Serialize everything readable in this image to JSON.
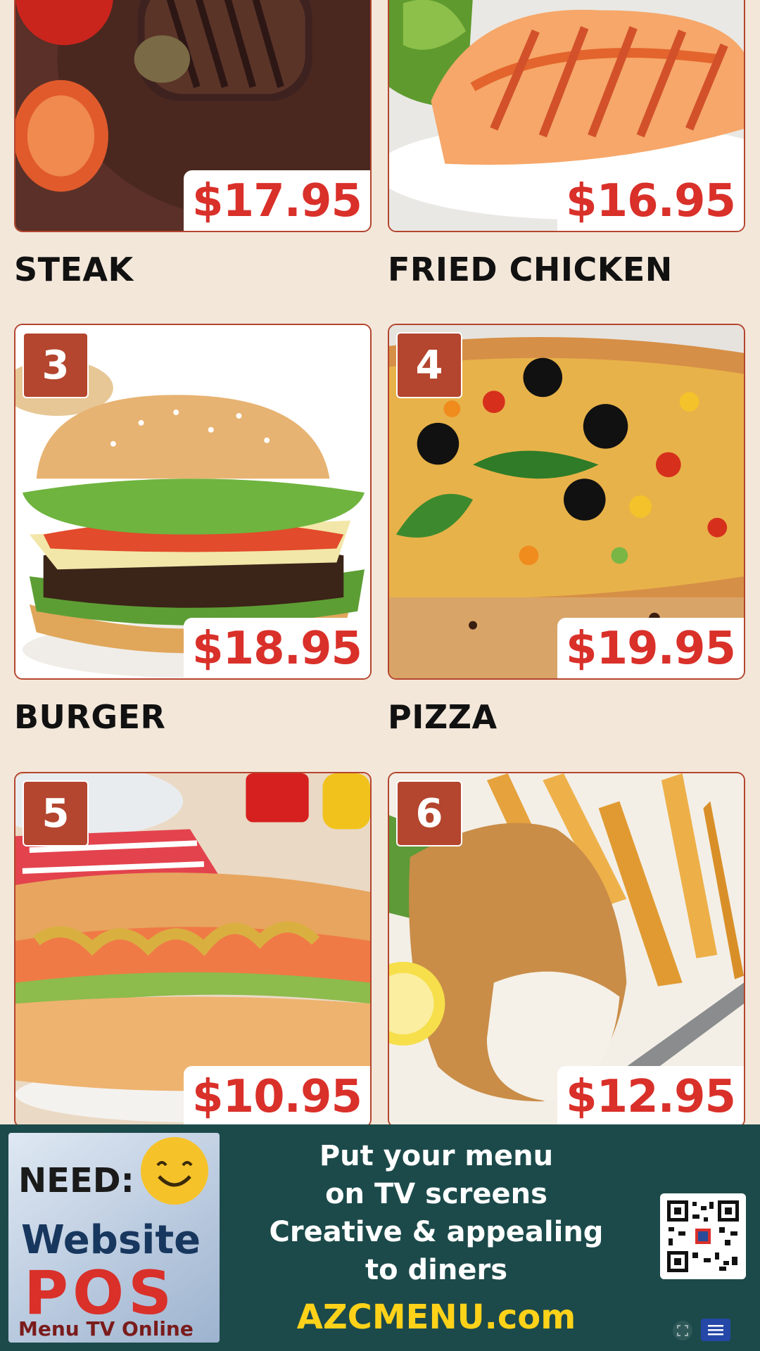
{
  "items": [
    {
      "number": "",
      "name": "STEAK",
      "price": "$17.95"
    },
    {
      "number": "",
      "name": "FRIED CHICKEN",
      "price": "$16.95"
    },
    {
      "number": "3",
      "name": "BURGER",
      "price": "$18.95"
    },
    {
      "number": "4",
      "name": "PIZZA",
      "price": "$19.95"
    },
    {
      "number": "5",
      "name": "",
      "price": "$10.95"
    },
    {
      "number": "6",
      "name": "",
      "price": "$12.95"
    }
  ],
  "banner": {
    "promo": {
      "need": "NEED:",
      "website": "Website",
      "pos": "POS",
      "menu_tv": "Menu TV Online"
    },
    "tagline": [
      "Put your menu",
      "on TV screens",
      "Creative & appealing",
      "to diners"
    ],
    "site": "AZCMENU.com"
  },
  "controls": {
    "fullscreen_icon": "fullscreen-icon",
    "menu_icon": "hamburger-menu-icon"
  },
  "colors": {
    "background": "#f3e7da",
    "accent": "#b4452e",
    "price_red": "#d9302a",
    "banner_bg": "#1c4a4a",
    "site_yellow": "#ffd21a"
  }
}
